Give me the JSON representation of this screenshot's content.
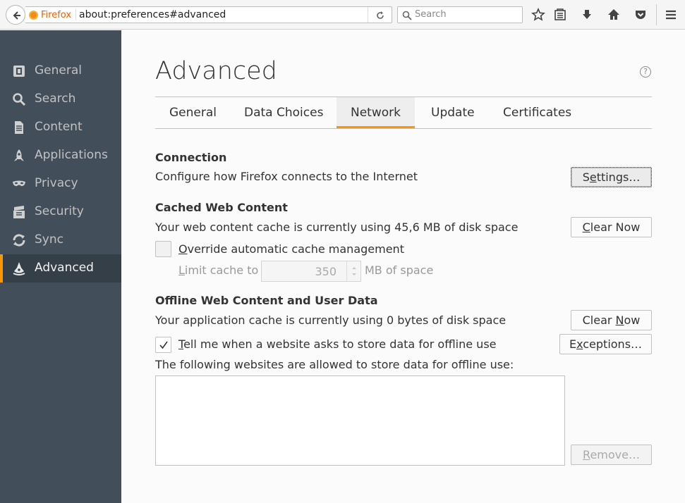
{
  "browser": {
    "identity_label": "Firefox",
    "url": "about:preferences#advanced",
    "search_placeholder": "Search"
  },
  "sidebar": {
    "items": [
      {
        "label": "General",
        "icon": "general-icon"
      },
      {
        "label": "Search",
        "icon": "search-icon"
      },
      {
        "label": "Content",
        "icon": "content-icon"
      },
      {
        "label": "Applications",
        "icon": "applications-icon"
      },
      {
        "label": "Privacy",
        "icon": "privacy-icon"
      },
      {
        "label": "Security",
        "icon": "security-icon"
      },
      {
        "label": "Sync",
        "icon": "sync-icon"
      },
      {
        "label": "Advanced",
        "icon": "advanced-icon",
        "selected": true
      }
    ]
  },
  "page": {
    "title": "Advanced",
    "help": "?",
    "tabs": [
      "General",
      "Data Choices",
      "Network",
      "Update",
      "Certificates"
    ],
    "active_tab": "Network"
  },
  "connection": {
    "heading": "Connection",
    "description": "Configure how Firefox connects to the Internet",
    "settings_pre": "S",
    "settings_key": "e",
    "settings_post": "ttings…"
  },
  "cache": {
    "heading": "Cached Web Content",
    "description": "Your web content cache is currently using 45,6 MB of disk space",
    "clear_key": "C",
    "clear_post": "lear Now",
    "override_key": "O",
    "override_post": "verride automatic cache management",
    "override_checked": false,
    "limit_key": "L",
    "limit_post": "imit cache to",
    "limit_value": "350",
    "limit_unit": "MB of space"
  },
  "offline": {
    "heading": "Offline Web Content and User Data",
    "description": "Your application cache is currently using 0 bytes of disk space",
    "clear_pre": "Clear ",
    "clear_key": "N",
    "clear_post": "ow",
    "tell_key": "T",
    "tell_post": "ell me when a website asks to store data for offline use",
    "tell_checked": true,
    "exceptions_pre": "E",
    "exceptions_key": "x",
    "exceptions_post": "ceptions…",
    "allowed_label": "The following websites are allowed to store data for offline use:",
    "remove_key": "R",
    "remove_post": "emove…"
  },
  "colors": {
    "sidebar_bg": "#424f5a",
    "sidebar_selected_bg": "#343f48",
    "accent": "#ff9500",
    "identity_orange": "#e66000"
  }
}
